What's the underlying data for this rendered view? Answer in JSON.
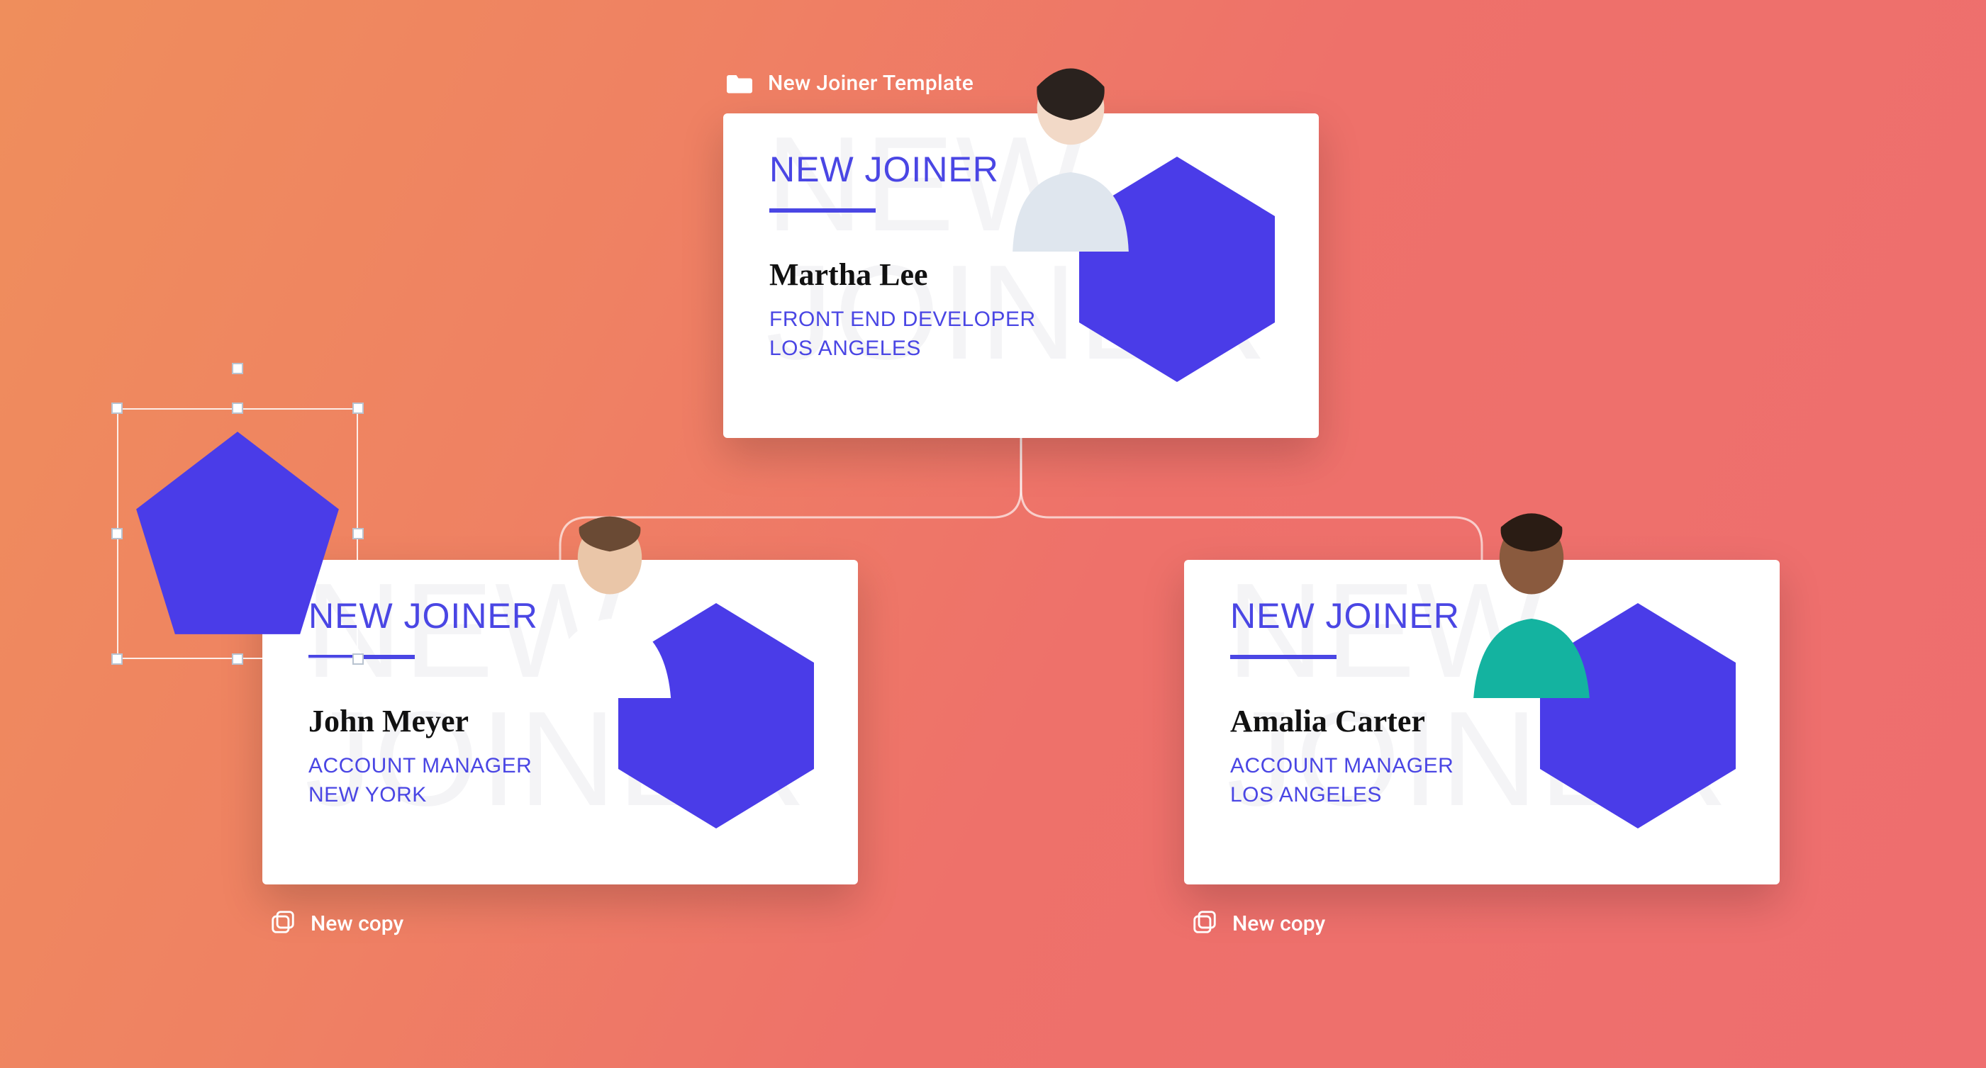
{
  "template": {
    "title": "New Joiner Template"
  },
  "cards": {
    "top": {
      "heading": "NEW JOINER",
      "watermark": "NEW\nJOINER",
      "name": "Martha Lee",
      "role": "FRONT END DEVELOPER",
      "location": "LOS ANGELES"
    },
    "left": {
      "heading": "NEW JOINER",
      "watermark": "NEW\nJOINER",
      "name": "John Meyer",
      "role": "ACCOUNT MANAGER",
      "location": "NEW YORK"
    },
    "right": {
      "heading": "NEW JOINER",
      "watermark": "NEW\nJOINER",
      "name": "Amalia Carter",
      "role": "ACCOUNT MANAGER",
      "location": "LOS ANGELES"
    }
  },
  "copy_labels": {
    "left": "New copy",
    "right": "New copy"
  },
  "colors": {
    "accent": "#4a46e4",
    "shape_fill": "#4a3ce8"
  },
  "shape": {
    "type": "pentagon",
    "selected": true
  }
}
